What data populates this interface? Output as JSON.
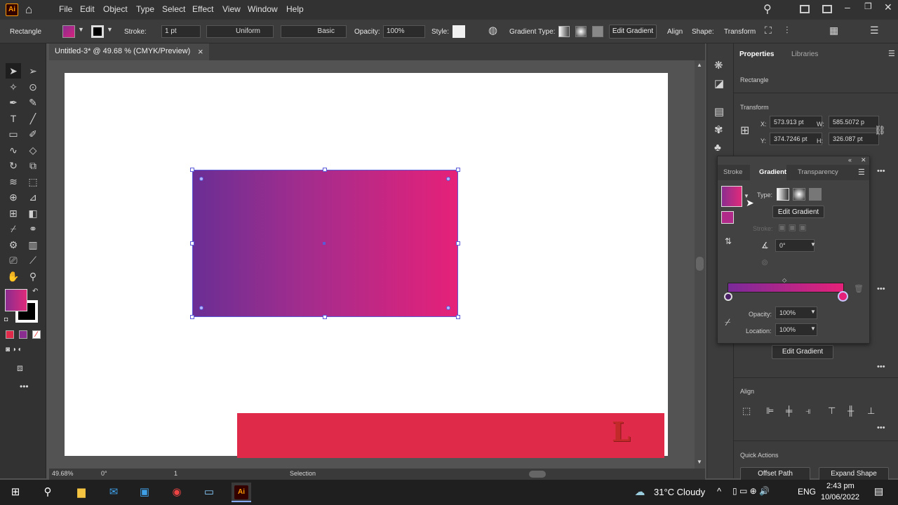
{
  "app": {
    "logo": "Ai"
  },
  "menu": [
    "File",
    "Edit",
    "Object",
    "Type",
    "Select",
    "Effect",
    "View",
    "Window",
    "Help"
  ],
  "control_bar": {
    "object_type": "Rectangle",
    "stroke_label": "Stroke:",
    "stroke_value": "1 pt",
    "profile": "Uniform",
    "brush": "Basic",
    "opacity_label": "Opacity:",
    "opacity_value": "100%",
    "style_label": "Style:",
    "gradient_type_label": "Gradient Type:",
    "edit_gradient": "Edit Gradient",
    "align": "Align",
    "shape": "Shape:",
    "transform": "Transform"
  },
  "document": {
    "tab_title": "Untitled-3* @ 49.68 % (CMYK/Preview)",
    "close_glyph": "×"
  },
  "artwork": {
    "gradient_start": "#6a2e94",
    "gradient_end": "#e62179",
    "bar_color": "#e02a4a",
    "bar_letter": "L"
  },
  "status": {
    "zoom": "49.68%",
    "rotation": "0°",
    "artboard": "1",
    "tool": "Selection"
  },
  "properties": {
    "tab_properties": "Properties",
    "tab_libraries": "Libraries",
    "selection": "Rectangle",
    "transform_title": "Transform",
    "x_label": "X:",
    "x_value": "573.913 pt",
    "y_label": "Y:",
    "y_value": "374.7246 pt",
    "w_label": "W:",
    "w_value": "585.5072 p",
    "h_label": "H:",
    "h_value": "326.087 pt",
    "edit_gradient": "Edit Gradient",
    "align_title": "Align",
    "quick_actions": "Quick Actions",
    "offset_path": "Offset Path",
    "expand_shape": "Expand Shape"
  },
  "gradient_panel": {
    "tab_stroke": "Stroke",
    "tab_gradient": "Gradient",
    "tab_transparency": "Transparency",
    "type_label": "Type:",
    "edit_gradient": "Edit Gradient",
    "stroke_label": "Stroke:",
    "angle": "0°",
    "opacity_label": "Opacity:",
    "opacity_value": "100%",
    "location_label": "Location:",
    "location_value": "100%"
  },
  "taskbar": {
    "weather": "31°C  Cloudy",
    "lang": "ENG",
    "time": "2:43 pm",
    "date": "10/06/2022"
  }
}
